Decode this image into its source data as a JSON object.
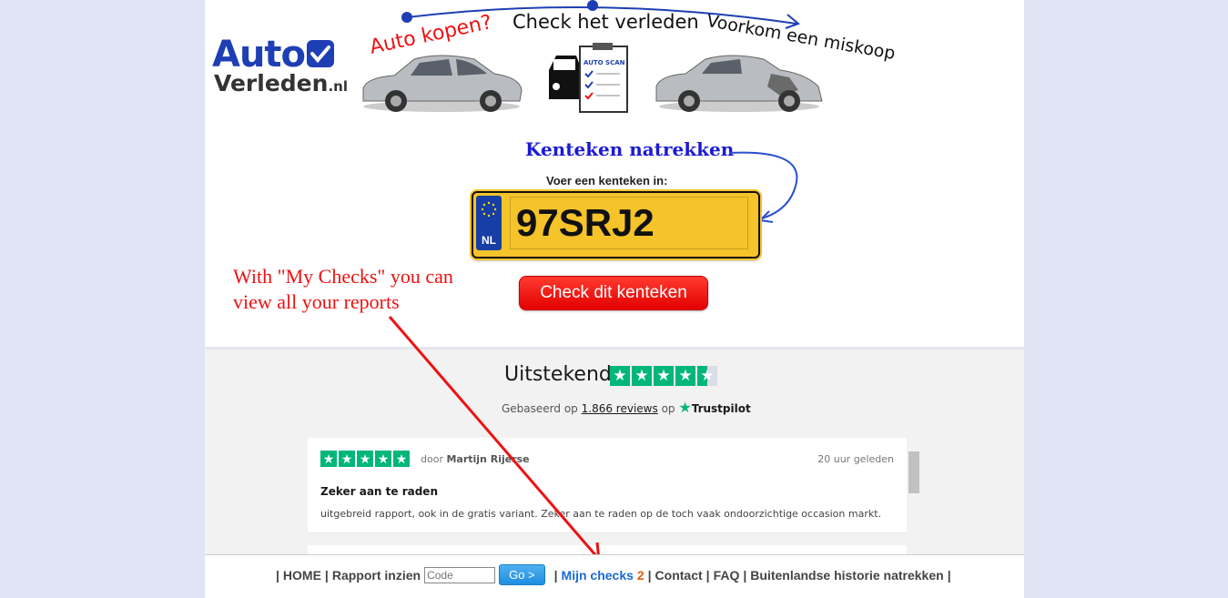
{
  "header": {
    "logo_auto": "Auto",
    "logo_verleden": "Verleden",
    "logo_tld": ".nl",
    "tagline_1": "Auto kopen?",
    "tagline_2": "Check het verleden",
    "tagline_3": "Voorkom een miskoop",
    "autoscan_label": "AUTO SCAN"
  },
  "form": {
    "title": "Kenteken natrekken",
    "label": "Voer een kenteken in:",
    "plate_country": "NL",
    "plate_value": "97SRJ2",
    "submit_label": "Check dit kenteken"
  },
  "annotation": {
    "text": "With \"My Checks\" you can view all your reports"
  },
  "trustpilot": {
    "rating_word": "Uitstekend",
    "based_prefix": "Gebaseerd op",
    "review_count": "1.866 reviews",
    "based_suffix": "op",
    "brand": "Trustpilot",
    "rating_stars": 4.5
  },
  "review": {
    "stars": 5,
    "by_prefix": "door",
    "author": "Martijn Rijerse",
    "time": "20 uur geleden",
    "title": "Zeker aan te raden",
    "body": "uitgebreid rapport, ook in de gratis variant. Zeker aan te raden op de toch vaak ondoorzichtige occasion markt."
  },
  "footer": {
    "home": "HOME",
    "rapport": "Rapport inzien",
    "code_placeholder": "Code",
    "go_label": "Go >",
    "mijn_checks": "Mijn checks",
    "mijn_checks_count": "2",
    "contact": "Contact",
    "faq": "FAQ",
    "buitenland": "Buitenlandse historie natrekken"
  },
  "colors": {
    "brand_blue": "#1e3fb4",
    "trustpilot_green": "#00b67a",
    "cta_red": "#e30000",
    "plate_yellow": "#f5c32a",
    "background": "#e0e5f5"
  }
}
